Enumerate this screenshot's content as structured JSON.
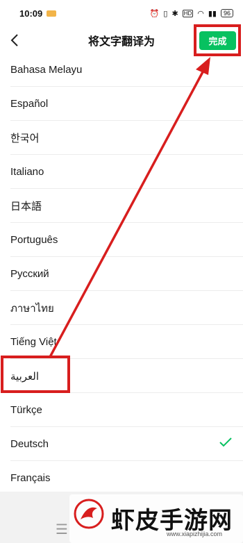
{
  "status_bar": {
    "time": "10:09",
    "battery": "96",
    "icons": [
      "notification-badge-icon",
      "alarm-icon",
      "vibrate-icon",
      "bluetooth-icon",
      "hd-icon",
      "wifi-icon",
      "signal-icon",
      "battery-icon"
    ]
  },
  "nav": {
    "back_icon": "chevron-left-icon",
    "title": "将文字翻译为",
    "done_label": "完成"
  },
  "languages": [
    {
      "label": "Bahasa Melayu",
      "selected": false
    },
    {
      "label": "Español",
      "selected": false
    },
    {
      "label": "한국어",
      "selected": false
    },
    {
      "label": "Italiano",
      "selected": false
    },
    {
      "label": "日本語",
      "selected": false
    },
    {
      "label": "Português",
      "selected": false
    },
    {
      "label": "Русский",
      "selected": false
    },
    {
      "label": "ภาษาไทย",
      "selected": false
    },
    {
      "label": "Tiếng Việt",
      "selected": false
    },
    {
      "label": "العربية",
      "selected": false
    },
    {
      "label": "Türkçe",
      "selected": false
    },
    {
      "label": "Deutsch",
      "selected": true
    },
    {
      "label": "Français",
      "selected": false
    }
  ],
  "watermark": {
    "name": "虾皮手游网",
    "url": "www.xiapizhijia.com"
  },
  "colors": {
    "accent": "#07c160",
    "annotation": "#d81e1e",
    "divider": "#ececec"
  }
}
